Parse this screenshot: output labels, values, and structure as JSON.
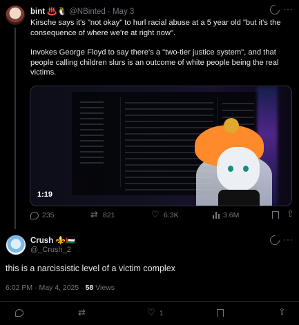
{
  "original_tweet": {
    "author_name": "bint",
    "author_emoji": "♨️🐧",
    "handle": "@NBinted",
    "separator": "·",
    "date": "May 3",
    "paragraphs": [
      "Kirsche says it's \"not okay\" to hurl racial abuse at a 5 year old \"but it's the consequence of where we're at right now\".",
      "Invokes George Floyd to say there's a \"two-tier justice system\", and that people calling children slurs is an outcome of white people being the real victims."
    ],
    "video_duration": "1:19",
    "stats": {
      "replies": "235",
      "reposts": "821",
      "likes": "6.3K",
      "views": "3.6M"
    }
  },
  "reply_tweet": {
    "author_name": "Crush",
    "author_emoji": "⚜️🇵🇸",
    "handle": "@_Crush_2",
    "text": "this is a narcissistic level of a victim complex",
    "time": "6:02 PM",
    "date": "May 4, 2025",
    "meta_separator": "·",
    "views_count": "58",
    "views_label": "Views",
    "stats": {
      "likes": "1"
    }
  },
  "icons": {
    "reply": "reply-icon",
    "repost": "repost-icon",
    "like": "like-icon",
    "views": "views-icon",
    "bookmark": "bookmark-icon",
    "share": "share-icon",
    "grok": "grok-icon",
    "more": "more-icon"
  }
}
